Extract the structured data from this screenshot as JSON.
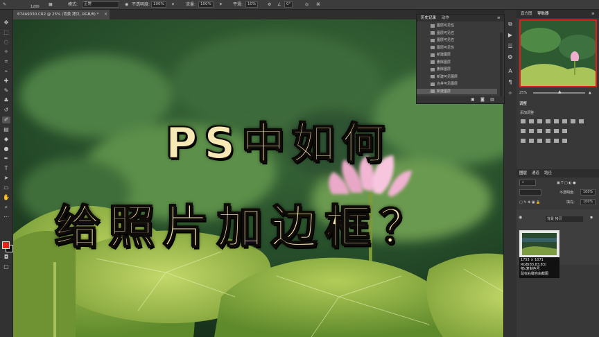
{
  "options_bar": {
    "brush_size": "1200",
    "mode_label": "模式:",
    "mode_value": "正常",
    "opacity_label": "不透明度:",
    "opacity_value": "100%",
    "flow_label": "流量:",
    "flow_value": "100%",
    "smoothing_label": "平滑:",
    "smoothing_value": "10%",
    "angle_value": "0°"
  },
  "document_tab": {
    "title": "874A9330.CR2 @ 25% (背景 拷贝, RGB/8) *",
    "close": "×"
  },
  "history_panel": {
    "tab_history": "历史记录",
    "tab_actions": "动作",
    "items": [
      "图层可见性",
      "图层可见性",
      "图层可见性",
      "图层可见性",
      "新建图层",
      "删除图层",
      "删除图层",
      "新建可见图层",
      "合并可见图层",
      "新建图层"
    ],
    "selected_index": 9
  },
  "navigator_panel": {
    "tab_histogram": "直方图",
    "tab_navigator": "导航器",
    "zoom": "25%"
  },
  "adjustments_panel": {
    "tab": "调整",
    "add_label": "添加调整"
  },
  "layers_panel": {
    "tab_layers": "图层",
    "tab_channels": "通道",
    "tab_paths": "路径",
    "opacity_label": "不透明度:",
    "opacity_value": "100%",
    "fill_label": "填充:",
    "fill_value": "100%",
    "layer_name": "背景 拷贝"
  },
  "tooltip": {
    "dimensions": "1753 × 1071",
    "rgb": "RGB(83,83,83)",
    "line3": "按c复制色号",
    "line4": "鼠标右键自由截图"
  },
  "overlay": {
    "line1": "PS中如何",
    "line2": "给照片加边框？"
  },
  "colors": {
    "foreground": "#e8231c",
    "background": "#111111",
    "title_fill": "#f7e9b6",
    "title_outline": "#0e0b08"
  }
}
